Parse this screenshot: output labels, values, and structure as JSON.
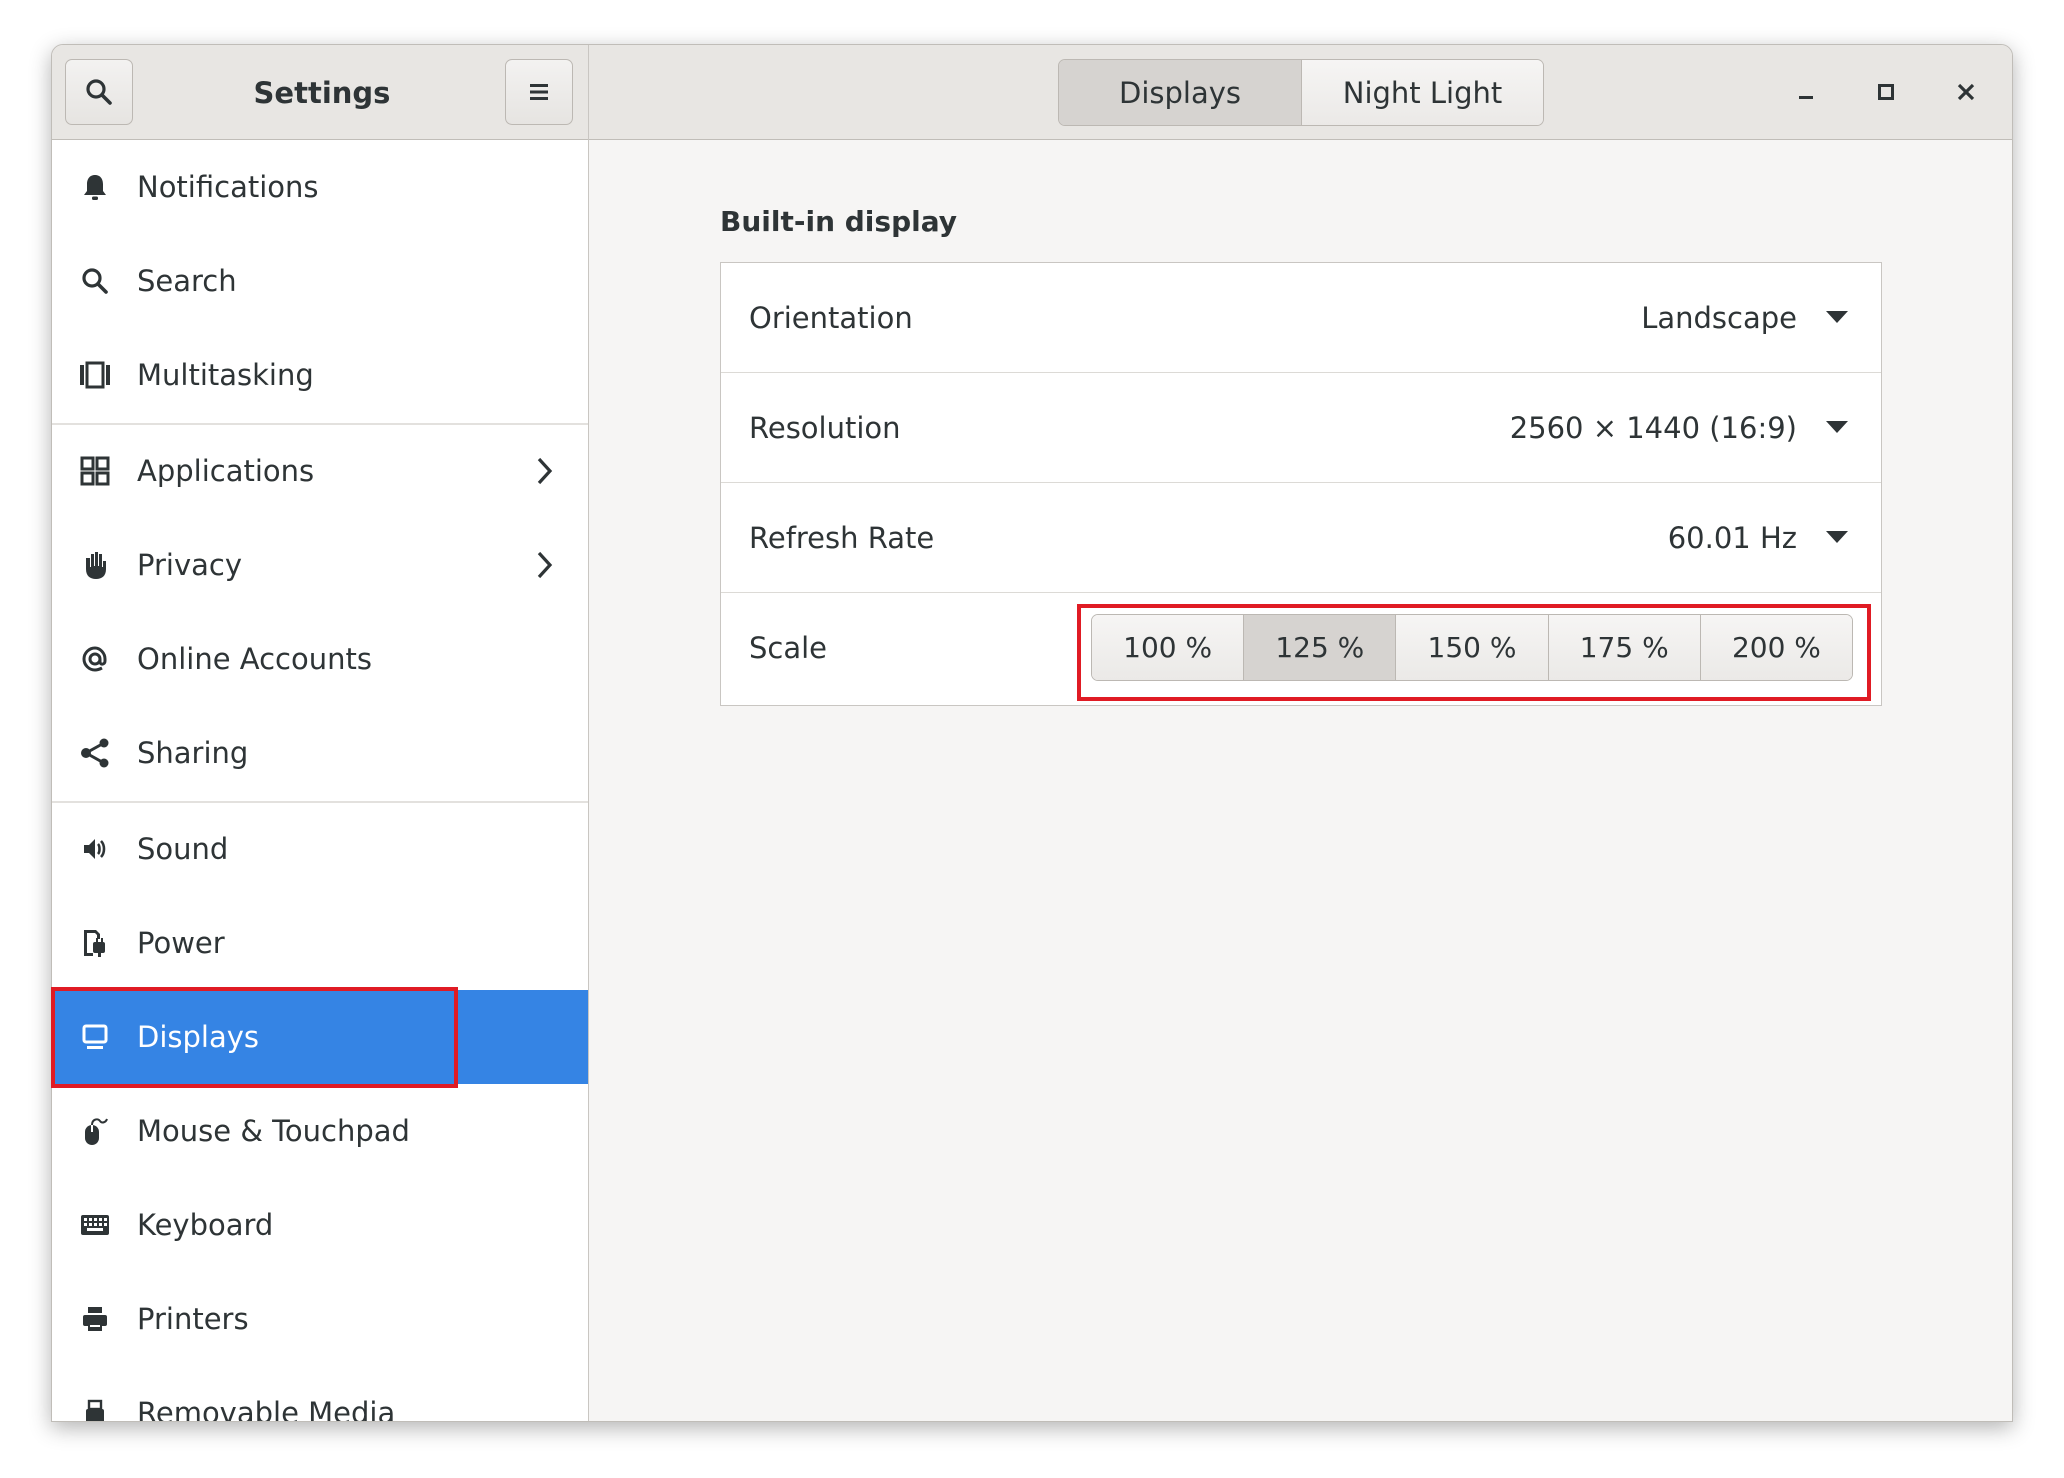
{
  "window": {
    "title": "Settings",
    "tabs": [
      {
        "label": "Displays",
        "active": true
      },
      {
        "label": "Night Light",
        "active": false
      }
    ],
    "controls": [
      "minimize-icon",
      "maximize-icon",
      "close-icon"
    ]
  },
  "sidebar": {
    "items": [
      {
        "label": "Notifications",
        "icon": "bell-icon"
      },
      {
        "label": "Search",
        "icon": "search-icon"
      },
      {
        "label": "Multitasking",
        "icon": "multitasking-icon"
      },
      {
        "label": "Applications",
        "icon": "applications-icon",
        "has_submenu": true
      },
      {
        "label": "Privacy",
        "icon": "hand-icon",
        "has_submenu": true
      },
      {
        "label": "Online Accounts",
        "icon": "at-icon"
      },
      {
        "label": "Sharing",
        "icon": "share-icon"
      },
      {
        "label": "Sound",
        "icon": "speaker-icon"
      },
      {
        "label": "Power",
        "icon": "power-plug-icon"
      },
      {
        "label": "Displays",
        "icon": "display-icon",
        "selected": true
      },
      {
        "label": "Mouse & Touchpad",
        "icon": "mouse-icon"
      },
      {
        "label": "Keyboard",
        "icon": "keyboard-icon"
      },
      {
        "label": "Printers",
        "icon": "printer-icon"
      },
      {
        "label": "Removable Media",
        "icon": "usb-icon"
      }
    ]
  },
  "display": {
    "section_title": "Built-in display",
    "rows": [
      {
        "label": "Orientation",
        "value": "Landscape"
      },
      {
        "label": "Resolution",
        "value": "2560 × 1440 (16:9)"
      },
      {
        "label": "Refresh Rate",
        "value": "60.01 Hz"
      }
    ],
    "scale": {
      "label": "Scale",
      "options": [
        "100 %",
        "125 %",
        "150 %",
        "175 %",
        "200 %"
      ],
      "selected": "125 %"
    }
  },
  "colors": {
    "accent": "#3584e4",
    "highlight": "#e01b24"
  }
}
